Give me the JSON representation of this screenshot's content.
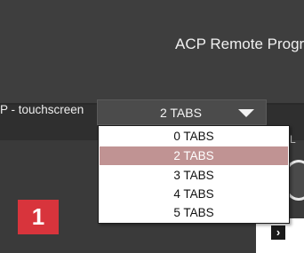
{
  "window": {
    "title": "ACP Remote Progr"
  },
  "toolbar": {
    "row_label": "P - touchscreen",
    "select": {
      "value": "2 TABS",
      "caret_icon": "caret-down-icon"
    }
  },
  "dropdown": {
    "options": [
      "0 TABS",
      "2 TABS",
      "3 TABS",
      "4 TABS",
      "5 TABS"
    ],
    "selected": "2 TABS",
    "highlight_color": "#c09393"
  },
  "content": {
    "partial_label": "L",
    "badge": {
      "text": "1",
      "color": "#d8343c"
    },
    "next_icon": "chevron-right-icon",
    "next_glyph": "›"
  }
}
